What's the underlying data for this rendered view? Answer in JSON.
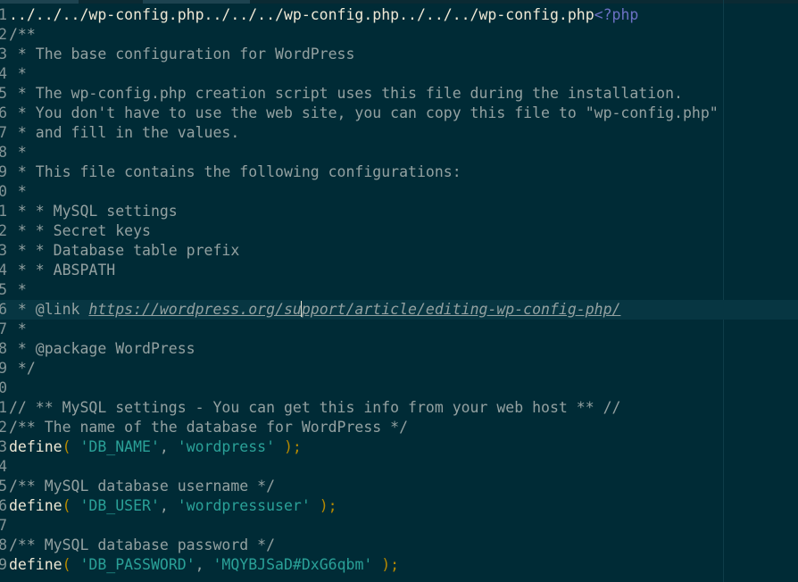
{
  "editor": {
    "colors": {
      "background": "#002b36",
      "current_line": "#073642",
      "comment": "#93a1a1",
      "string": "#2aa198",
      "paren": "#b58900",
      "php_tag": "#6c71c4",
      "plain": "#eee8d5"
    },
    "lines": [
      {
        "num": "1",
        "segments": [
          {
            "text": "../../../wp-config.php../../../wp-config.php../../../wp-config.php",
            "kind": "plain"
          },
          {
            "text": "<?php",
            "kind": "tag"
          }
        ]
      },
      {
        "num": "2",
        "segments": [
          {
            "text": "/**",
            "kind": "comment"
          }
        ]
      },
      {
        "num": "3",
        "segments": [
          {
            "text": " * The base configuration for WordPress",
            "kind": "comment"
          }
        ]
      },
      {
        "num": "4",
        "segments": [
          {
            "text": " *",
            "kind": "comment"
          }
        ]
      },
      {
        "num": "5",
        "segments": [
          {
            "text": " * The wp-config.php creation script uses this file during the installation.",
            "kind": "comment"
          }
        ]
      },
      {
        "num": "6",
        "segments": [
          {
            "text": " * You don't have to use the web site, you can copy this file to \"wp-config.php\"",
            "kind": "comment"
          }
        ]
      },
      {
        "num": "7",
        "segments": [
          {
            "text": " * and fill in the values.",
            "kind": "comment"
          }
        ]
      },
      {
        "num": "8",
        "segments": [
          {
            "text": " *",
            "kind": "comment"
          }
        ]
      },
      {
        "num": "9",
        "segments": [
          {
            "text": " * This file contains the following configurations:",
            "kind": "comment"
          }
        ]
      },
      {
        "num": "0",
        "segments": [
          {
            "text": " *",
            "kind": "comment"
          }
        ]
      },
      {
        "num": "1",
        "segments": [
          {
            "text": " * * MySQL settings",
            "kind": "comment"
          }
        ]
      },
      {
        "num": "2",
        "segments": [
          {
            "text": " * * Secret keys",
            "kind": "comment"
          }
        ]
      },
      {
        "num": "3",
        "segments": [
          {
            "text": " * * Database table prefix",
            "kind": "comment"
          }
        ]
      },
      {
        "num": "4",
        "segments": [
          {
            "text": " * * ABSPATH",
            "kind": "comment"
          }
        ]
      },
      {
        "num": "5",
        "segments": [
          {
            "text": " *",
            "kind": "comment"
          }
        ]
      },
      {
        "num": "6",
        "current": true,
        "segments": [
          {
            "text": " * @link ",
            "kind": "comment"
          },
          {
            "text": "https://wordpress.org/su",
            "kind": "link"
          },
          {
            "text": "",
            "kind": "caret"
          },
          {
            "text": "pport/article/editing-wp-config-php/",
            "kind": "link"
          }
        ]
      },
      {
        "num": "7",
        "segments": [
          {
            "text": " *",
            "kind": "comment"
          }
        ]
      },
      {
        "num": "8",
        "segments": [
          {
            "text": " * @package WordPress",
            "kind": "comment"
          }
        ]
      },
      {
        "num": "9",
        "segments": [
          {
            "text": " */",
            "kind": "comment"
          }
        ]
      },
      {
        "num": "0",
        "segments": []
      },
      {
        "num": "1",
        "segments": [
          {
            "text": "// ** MySQL settings - You can get this info from your web host ** //",
            "kind": "comment"
          }
        ]
      },
      {
        "num": "2",
        "segments": [
          {
            "text": "/** The name of the database for WordPress */",
            "kind": "comment"
          }
        ]
      },
      {
        "num": "3",
        "segments": [
          {
            "text": "define",
            "kind": "func"
          },
          {
            "text": "(",
            "kind": "paren"
          },
          {
            "text": " ",
            "kind": "plain"
          },
          {
            "text": "'DB_NAME'",
            "kind": "string"
          },
          {
            "text": ", ",
            "kind": "punct"
          },
          {
            "text": "'wordpress'",
            "kind": "string"
          },
          {
            "text": " ",
            "kind": "plain"
          },
          {
            "text": ");",
            "kind": "paren"
          }
        ]
      },
      {
        "num": "4",
        "segments": []
      },
      {
        "num": "5",
        "segments": [
          {
            "text": "/** MySQL database username */",
            "kind": "comment"
          }
        ]
      },
      {
        "num": "6",
        "segments": [
          {
            "text": "define",
            "kind": "func"
          },
          {
            "text": "(",
            "kind": "paren"
          },
          {
            "text": " ",
            "kind": "plain"
          },
          {
            "text": "'DB_USER'",
            "kind": "string"
          },
          {
            "text": ", ",
            "kind": "punct"
          },
          {
            "text": "'wordpressuser'",
            "kind": "string"
          },
          {
            "text": " ",
            "kind": "plain"
          },
          {
            "text": ");",
            "kind": "paren"
          }
        ]
      },
      {
        "num": "7",
        "segments": []
      },
      {
        "num": "8",
        "segments": [
          {
            "text": "/** MySQL database password */",
            "kind": "comment"
          }
        ]
      },
      {
        "num": "9",
        "segments": [
          {
            "text": "define",
            "kind": "func"
          },
          {
            "text": "(",
            "kind": "paren"
          },
          {
            "text": " ",
            "kind": "plain"
          },
          {
            "text": "'DB_PASSWORD'",
            "kind": "string"
          },
          {
            "text": ", ",
            "kind": "punct"
          },
          {
            "text": "'MQYBJSaD#DxG6qbm'",
            "kind": "string"
          },
          {
            "text": " ",
            "kind": "plain"
          },
          {
            "text": ");",
            "kind": "paren"
          }
        ]
      }
    ]
  }
}
